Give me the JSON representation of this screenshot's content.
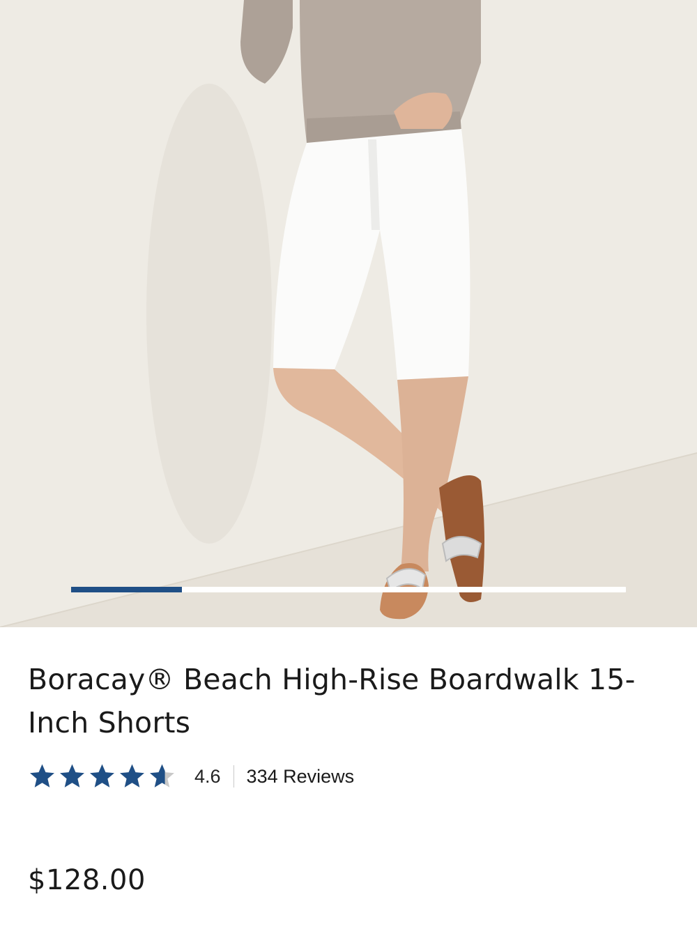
{
  "product": {
    "title": "Boracay® Beach High-Rise Boardwalk 15-Inch Shorts",
    "rating_value": "4.6",
    "rating_stars": 4.6,
    "rating_max": 5,
    "reviews_label": "334 Reviews",
    "price": "$128.00"
  },
  "gallery": {
    "image_label": "product-photo-white-shorts",
    "progress": 0.2
  },
  "colors": {
    "accent": "#1f4f86",
    "star_empty": "#c8c8c8"
  }
}
